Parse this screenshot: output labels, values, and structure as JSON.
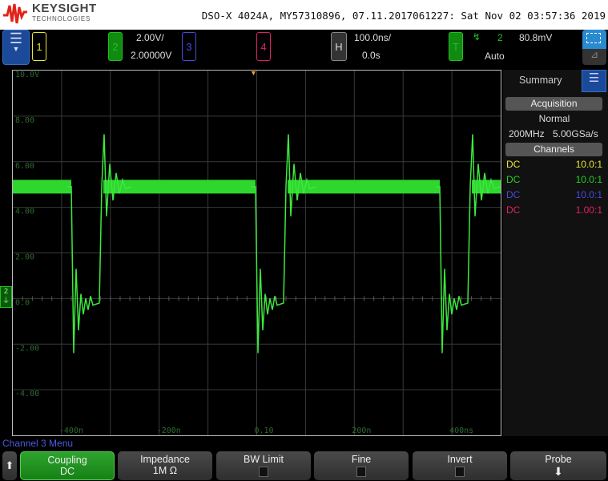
{
  "header": {
    "brand": "KEYSIGHT",
    "brand_sub": "TECHNOLOGIES",
    "title": "DSO-X 4024A, MY57310896, 07.11.2017061227: Sat Nov 02 03:57:36 2019"
  },
  "channels": [
    {
      "num": "1",
      "color": "#e6e63c"
    },
    {
      "num": "2",
      "color": "#22c022",
      "scale": "2.00V/",
      "offset": "2.00000V"
    },
    {
      "num": "3",
      "color": "#4a4ae0"
    },
    {
      "num": "4",
      "color": "#e0206a"
    }
  ],
  "horizontal": {
    "label": "H",
    "scale": "100.0ns/",
    "delay": "0.0s"
  },
  "trigger": {
    "label": "T",
    "slope_icon": "falling-edge-icon",
    "source": "2",
    "level": "80.8mV",
    "mode": "Auto"
  },
  "graticule": {
    "y_labels": [
      "10.0V",
      "8.00",
      "6.00",
      "4.00",
      "2.00",
      "0.0",
      "-2.00",
      "-4.00"
    ],
    "x_labels": [
      "-400n",
      "-200n",
      "0.10",
      "200n",
      "400ns"
    ],
    "ground_marker": "2"
  },
  "summary": {
    "title": "Summary",
    "acq_title": "Acquisition",
    "mode": "Normal",
    "bw": "200MHz",
    "rate": "5.00GSa/s",
    "channels_title": "Channels",
    "rows": [
      {
        "coupling": "DC",
        "probe": "10.0:1",
        "color": "#e6e63c"
      },
      {
        "coupling": "DC",
        "probe": "10.0:1",
        "color": "#22d022"
      },
      {
        "coupling": "DC",
        "probe": "10.0:1",
        "color": "#4a4ae0"
      },
      {
        "coupling": "DC",
        "probe": "1.00:1",
        "color": "#e0206a"
      }
    ]
  },
  "menu": {
    "title": "Channel 3 Menu",
    "softkeys": [
      {
        "label": "Coupling",
        "value": "DC"
      },
      {
        "label": "Impedance",
        "value": "1M Ω"
      },
      {
        "label": "BW Limit"
      },
      {
        "label": "Fine"
      },
      {
        "label": "Invert"
      },
      {
        "label": "Probe"
      }
    ]
  }
}
